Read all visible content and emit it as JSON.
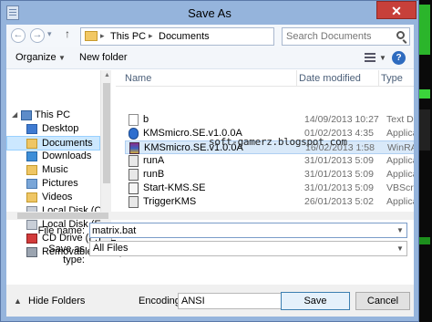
{
  "window": {
    "title": "Save As",
    "close_label": "✕"
  },
  "address": {
    "crumbs": [
      "This PC",
      "Documents"
    ],
    "separator": "▸",
    "search_placeholder": "Search Documents"
  },
  "toolbar": {
    "organize": "Organize",
    "new_folder": "New folder",
    "help": "?"
  },
  "nav": {
    "items": [
      {
        "label": "This PC",
        "icon": "computer-icon"
      },
      {
        "label": "Desktop",
        "icon": "desktop-folder-icon"
      },
      {
        "label": "Documents",
        "icon": "documents-folder-icon"
      },
      {
        "label": "Downloads",
        "icon": "downloads-folder-icon"
      },
      {
        "label": "Music",
        "icon": "music-folder-icon"
      },
      {
        "label": "Pictures",
        "icon": "pictures-folder-icon"
      },
      {
        "label": "Videos",
        "icon": "videos-folder-icon"
      },
      {
        "label": "Local Disk (C:)",
        "icon": "drive-icon"
      },
      {
        "label": "Local Disk (E:)",
        "icon": "drive-icon"
      },
      {
        "label": "CD Drive (F:) TEL",
        "icon": "cd-drive-icon"
      },
      {
        "label": "Removable Disk (",
        "icon": "removable-drive-icon"
      }
    ]
  },
  "columns": {
    "name": "Name",
    "date": "Date modified",
    "type": "Type"
  },
  "files": [
    {
      "name": "b",
      "date": "14/09/2013 10:27",
      "type": "Text Docume",
      "icon": "text-file-icon"
    },
    {
      "name": "KMSmicro.SE.v1.0.0A",
      "date": "01/02/2013 4:35",
      "type": "Application",
      "icon": "app-file-icon"
    },
    {
      "name": "KMSmicro.SE.v1.0.0A",
      "date": "16/02/2013 1:58",
      "type": "WinRAR arch",
      "icon": "winrar-file-icon"
    },
    {
      "name": "runA",
      "date": "31/01/2013 5:09",
      "type": "Application",
      "icon": "app-file-icon"
    },
    {
      "name": "runB",
      "date": "31/01/2013 5:09",
      "type": "Application",
      "icon": "app-file-icon"
    },
    {
      "name": "Start-KMS.SE",
      "date": "31/01/2013 5:09",
      "type": "VBScript Scri",
      "icon": "script-file-icon"
    },
    {
      "name": "TriggerKMS",
      "date": "26/01/2013 5:02",
      "type": "Application",
      "icon": "app-file-icon"
    }
  ],
  "watermark": "soft-gamerz.blogspot.com",
  "form": {
    "filename_label": "File name:",
    "filename_value": "matrix.bat",
    "savetype_label": "Save as type:",
    "savetype_value": "All Files"
  },
  "bottom": {
    "hide_folders": "Hide Folders",
    "encoding_label": "Encoding:",
    "encoding_value": "ANSI",
    "save": "Save",
    "cancel": "Cancel"
  },
  "colors": {
    "titlebar": "#95b4dc",
    "close": "#c7403a",
    "selection": "#cce8ff"
  }
}
